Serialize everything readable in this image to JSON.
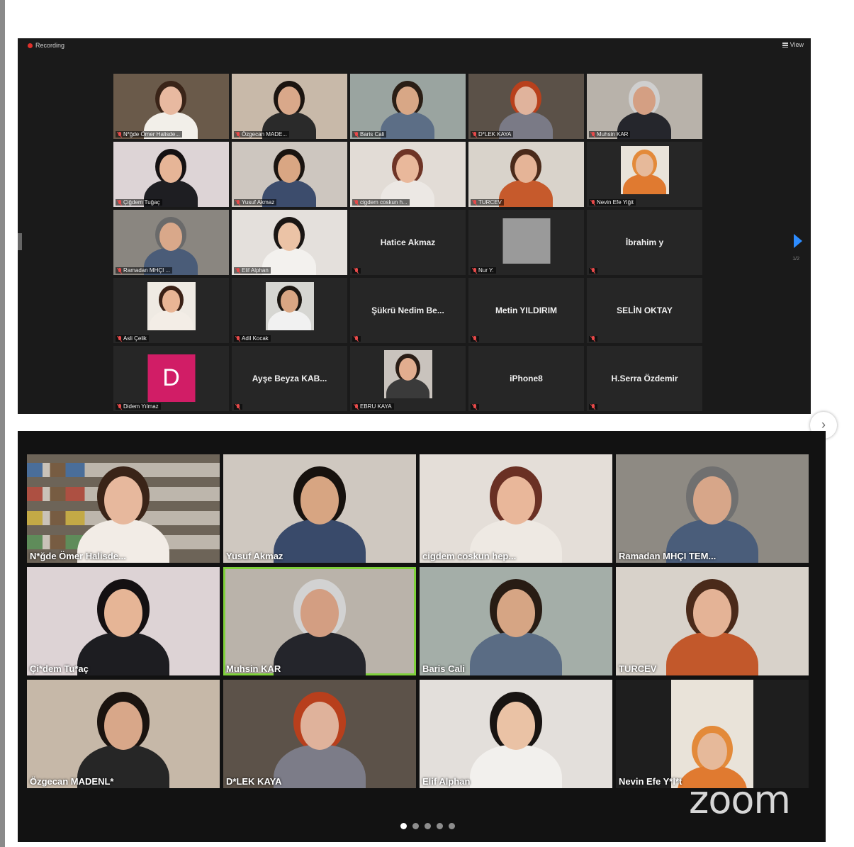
{
  "top_meeting": {
    "recording_label": "Recording",
    "view_label": "View",
    "page_indicator": "1/2",
    "tiles": [
      {
        "name": "N*ğde Ömer Halisde...",
        "kind": "video",
        "bg": "#6a5a4a",
        "skin": "#e8b9a0",
        "hair": "#3a2418",
        "shirt": "#f2efe9",
        "active": true
      },
      {
        "name": "Özgecan MADE...",
        "kind": "video",
        "bg": "#c8b9a9",
        "skin": "#d9a88a",
        "hair": "#1b1410",
        "shirt": "#2a2a2a"
      },
      {
        "name": "Baris Cali",
        "kind": "video",
        "bg": "#9aa4a0",
        "skin": "#d8a786",
        "hair": "#2a1e15",
        "shirt": "#5c6e86"
      },
      {
        "name": "D*LEK KAYA",
        "kind": "video",
        "bg": "#5b5148",
        "skin": "#e0b39c",
        "hair": "#b8401c",
        "shirt": "#7a7a86"
      },
      {
        "name": "Muhsin KAR",
        "kind": "video",
        "bg": "#b8b2aa",
        "skin": "#d49f83",
        "hair": "#cfcfcf",
        "shirt": "#25262c"
      },
      {
        "name": "Çiğdem Tuğaç",
        "kind": "video",
        "bg": "#ddd4d6",
        "skin": "#e6b597",
        "hair": "#151112",
        "shirt": "#1e1e22"
      },
      {
        "name": "Yusuf Akmaz",
        "kind": "video",
        "bg": "#cdc6bf",
        "skin": "#d9a683",
        "hair": "#1a1410",
        "shirt": "#3c4c6c"
      },
      {
        "name": "cigdem coskun h...",
        "kind": "video",
        "bg": "#e2dcd6",
        "skin": "#e9b89b",
        "hair": "#6e3426",
        "shirt": "#ece8e4"
      },
      {
        "name": "TURCEV",
        "kind": "video",
        "bg": "#d9d3cb",
        "skin": "#e5b497",
        "hair": "#4a2a1a",
        "shirt": "#c65a2c"
      },
      {
        "name": "Nevin Efe Yiğit",
        "kind": "thumb",
        "bg": "#e9e3d9",
        "skin": "#e6b99a",
        "hair": "#e38a3a",
        "shirt": "#e07a30"
      },
      {
        "name": "Ramadan MHÇI ...",
        "kind": "video",
        "bg": "#8a8680",
        "skin": "#d9a88a",
        "hair": "#6a6a6a",
        "shirt": "#4a5c78"
      },
      {
        "name": "Elif Alphan",
        "kind": "video",
        "bg": "#e4e0dc",
        "skin": "#ebc3a6",
        "hair": "#1a1614",
        "shirt": "#f3f1ee"
      },
      {
        "name": "Hatice Akmaz",
        "kind": "name_only"
      },
      {
        "name": "Nur Y.",
        "kind": "blank_thumb"
      },
      {
        "name": "İbrahim y",
        "kind": "name_only"
      },
      {
        "name": "Asli Çelik",
        "kind": "thumb",
        "bg": "#efeae3",
        "skin": "#e9b595",
        "hair": "#3b2116",
        "shirt": "#f3ede6"
      },
      {
        "name": "Adil Kocak",
        "kind": "thumb",
        "bg": "#d6d6d2",
        "skin": "#d9a683",
        "hair": "#1c1712",
        "shirt": "#f1f1f1"
      },
      {
        "name": "Şükrü Nedim Be...",
        "kind": "name_only"
      },
      {
        "name": "Metin YILDIRIM",
        "kind": "name_only"
      },
      {
        "name": "SELİN OKTAY",
        "kind": "name_only"
      },
      {
        "name": "Didem Yılmaz",
        "kind": "avatar",
        "initial": "D"
      },
      {
        "name": "Ayşe Beyza KAB...",
        "kind": "name_only"
      },
      {
        "name": "EBRU KAYA",
        "kind": "thumb",
        "bg": "#c9c3bd",
        "skin": "#e2ad8f",
        "hair": "#2a1d16",
        "shirt": "#3a3a3a"
      },
      {
        "name": "iPhone8",
        "kind": "name_only"
      },
      {
        "name": "H.Serra Özdemir",
        "kind": "name_only"
      }
    ]
  },
  "bottom_meeting": {
    "logo_text": "zoom",
    "page_dots": 5,
    "active_dot": 0,
    "tiles": [
      {
        "name": "N*ğde Ömer Halisde...",
        "bg": "#6d6458",
        "skin": "#e7b89d",
        "hair": "#3a2418",
        "shirt": "#f2ece6",
        "shelves": true
      },
      {
        "name": "Yusuf Akmaz",
        "bg": "#cfc8c0",
        "skin": "#d7a582",
        "hair": "#17120e",
        "shirt": "#394a6a"
      },
      {
        "name": "cigdem coskun hep...",
        "bg": "#e4ded8",
        "skin": "#e9b79a",
        "hair": "#6a3024",
        "shirt": "#eee9e3"
      },
      {
        "name": "Ramadan MHÇI TEM...",
        "bg": "#8e8a83",
        "skin": "#d7a689",
        "hair": "#707070",
        "shirt": "#4a5d7a"
      },
      {
        "name": "Çi*dem Tu*aç",
        "bg": "#ddd3d5",
        "skin": "#e6b596",
        "hair": "#141012",
        "shirt": "#1d1d21"
      },
      {
        "name": "Muhsin KAR",
        "bg": "#bab3aa",
        "skin": "#d39e82",
        "hair": "#d2d2d2",
        "shirt": "#24252b",
        "active": true
      },
      {
        "name": "Baris Cali",
        "bg": "#a4aea8",
        "skin": "#d6a584",
        "hair": "#281c14",
        "shirt": "#5a6c84"
      },
      {
        "name": "TURCEV",
        "bg": "#d8d2ca",
        "skin": "#e4b396",
        "hair": "#4a2a1a",
        "shirt": "#c2582b"
      },
      {
        "name": "Özgecan MADENL*",
        "bg": "#c6b8a8",
        "skin": "#d8a789",
        "hair": "#1a130f",
        "shirt": "#262626"
      },
      {
        "name": "D*LEK KAYA",
        "bg": "#5c5249",
        "skin": "#dfb29b",
        "hair": "#b83f1c",
        "shirt": "#7c7c88"
      },
      {
        "name": "Elif Alphan",
        "bg": "#e3dfdb",
        "skin": "#eac2a5",
        "hair": "#181412",
        "shirt": "#f2f0ed"
      },
      {
        "name": "Nevin Efe Y*l*t",
        "bg": "#1e1e1e",
        "skin": "#e6b99a",
        "hair": "#e38a3a",
        "shirt": "#e07a30",
        "thumb": true
      }
    ]
  }
}
